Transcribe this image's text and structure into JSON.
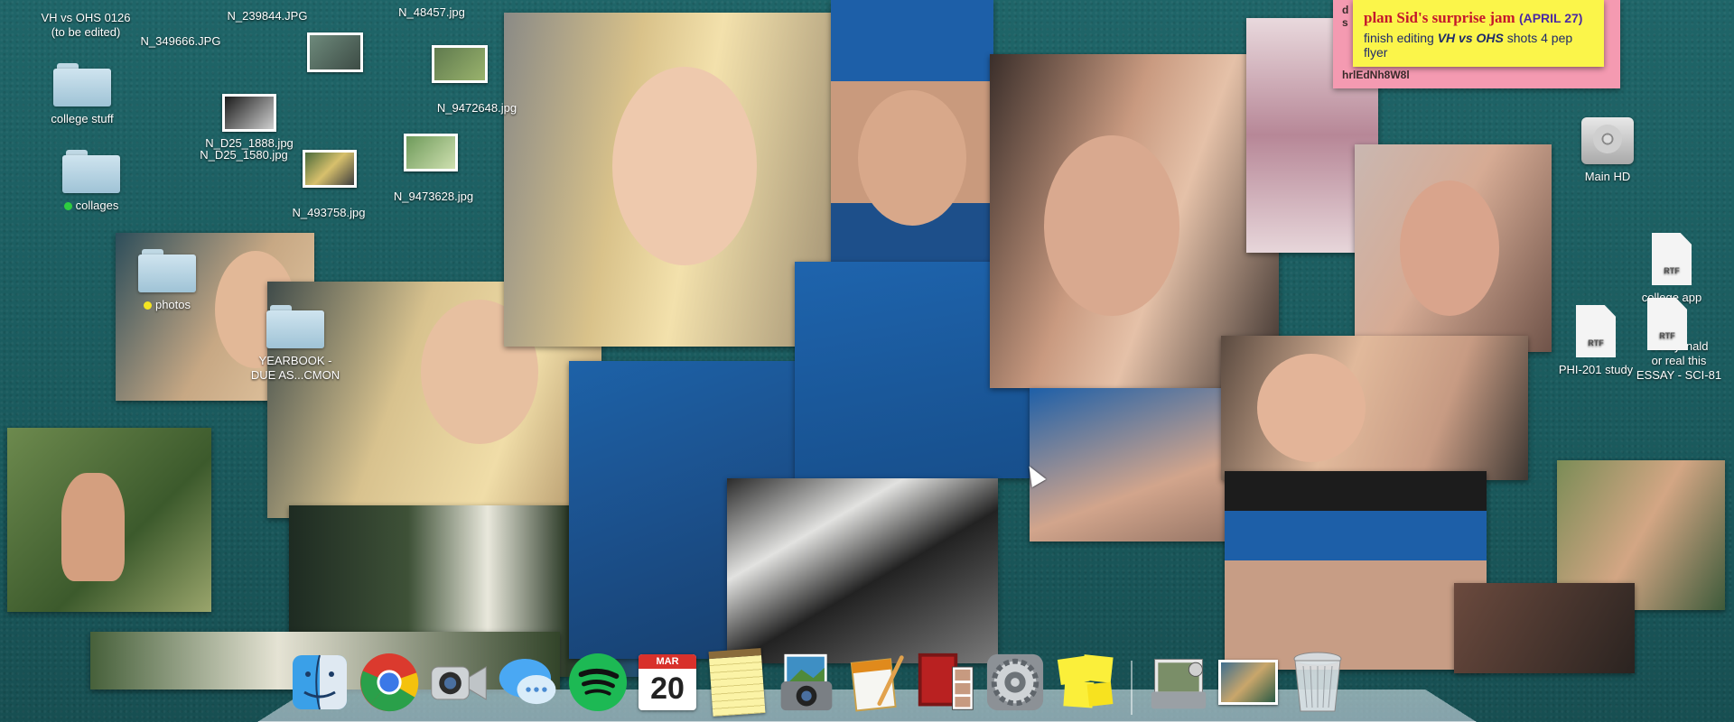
{
  "desktop": {
    "icons": {
      "vh_vs_ohs": "VH vs OHS 0126\n(to be edited)",
      "n_239844": "N_239844.JPG",
      "n_48457": "N_48457.jpg",
      "n_349666": "N_349666.JPG",
      "college_stuff": "college stuff",
      "n_d25_1888": "N_D25_1888.jpg",
      "n_9472648": "N_9472648.jpg",
      "n_d25_1580": "N_D25_1580.jpg",
      "collages": "collages",
      "n_493758": "N_493758.jpg",
      "n_9473628": "N_9473628.jpg",
      "photos": "photos",
      "yearbook": "YEARBOOK -\nDUE AS...CMON",
      "main_hd": "Main HD",
      "college_app": "college app",
      "phi_201": "PHI-201 study",
      "essay_final": "essayfinald\nor real this\nESSAY - SCI-81",
      "rtf_badge": "RTF"
    },
    "tag_colors": {
      "collages": "#2ecc40",
      "photos": "#f4e422"
    }
  },
  "sticky_pink": {
    "top_text": "d\ns",
    "bottom_text": "hrlEdNh8W8l"
  },
  "sticky_yellow": {
    "title": "plan Sid's surprise jam",
    "date": "(APRIL 27)",
    "line2_pre": "finish editing ",
    "line2_em": "VH vs OHS",
    "line2_post": " shots 4 pep flyer"
  },
  "dock": {
    "items": [
      "Finder",
      "Google Chrome",
      "FaceTime",
      "Messages",
      "Spotify",
      "Calendar",
      "Notes",
      "iPhoto",
      "Pages",
      "Photo Booth",
      "System Preferences",
      "Stickies",
      "Preview",
      "Downloads",
      "Trash"
    ],
    "calendar_month": "MAR",
    "calendar_day": "20"
  }
}
